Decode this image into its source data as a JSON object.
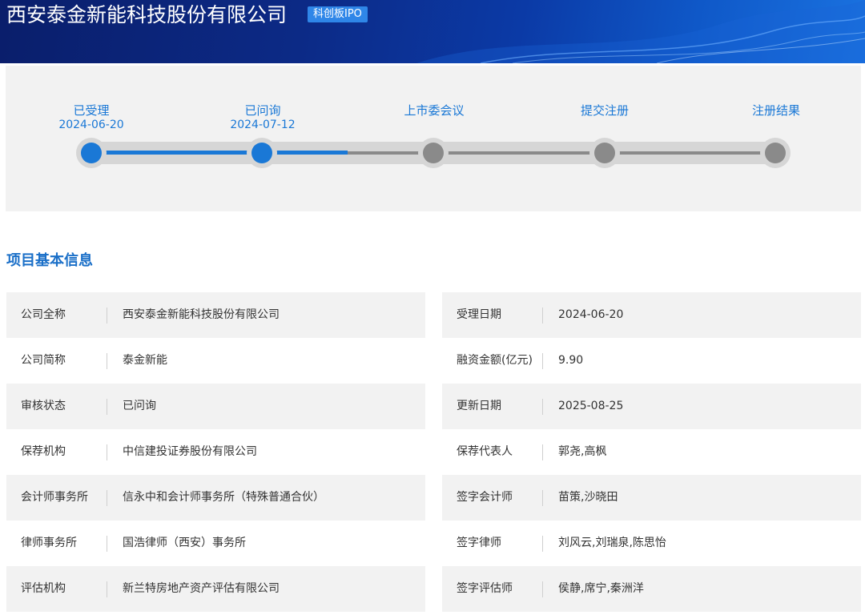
{
  "header": {
    "company_name": "西安泰金新能科技股份有限公司",
    "board_tag": "科创板IPO"
  },
  "progress": {
    "stages": [
      {
        "label": "已受理",
        "date": "2024-06-20",
        "active": true
      },
      {
        "label": "已问询",
        "date": "2024-07-12",
        "active": true
      },
      {
        "label": "上市委会议",
        "date": "",
        "active": false
      },
      {
        "label": "提交注册",
        "date": "",
        "active": false
      },
      {
        "label": "注册结果",
        "date": "",
        "active": false
      }
    ],
    "colors": {
      "active": "#1a78d6",
      "inactive": "#8a8a8a",
      "track": "#d6d6d6"
    }
  },
  "section": {
    "title": "项目基本信息"
  },
  "info": {
    "left": [
      {
        "label": "公司全称",
        "value": "西安泰金新能科技股份有限公司"
      },
      {
        "label": "公司简称",
        "value": "泰金新能"
      },
      {
        "label": "审核状态",
        "value": "已问询"
      },
      {
        "label": "保荐机构",
        "value": "中信建投证券股份有限公司"
      },
      {
        "label": "会计师事务所",
        "value": "信永中和会计师事务所（特殊普通合伙）"
      },
      {
        "label": "律师事务所",
        "value": "国浩律师（西安）事务所"
      },
      {
        "label": "评估机构",
        "value": "新兰特房地产资产评估有限公司"
      }
    ],
    "right": [
      {
        "label": "受理日期",
        "value": "2024-06-20"
      },
      {
        "label": "融资金额(亿元)",
        "value": "9.90"
      },
      {
        "label": "更新日期",
        "value": "2025-08-25"
      },
      {
        "label": "保荐代表人",
        "value": "郭尧,高枫"
      },
      {
        "label": "签字会计师",
        "value": "苗策,沙晓田"
      },
      {
        "label": "签字律师",
        "value": "刘风云,刘瑞泉,陈思怡"
      },
      {
        "label": "签字评估师",
        "value": "侯静,席宁,秦洲洋"
      }
    ]
  }
}
